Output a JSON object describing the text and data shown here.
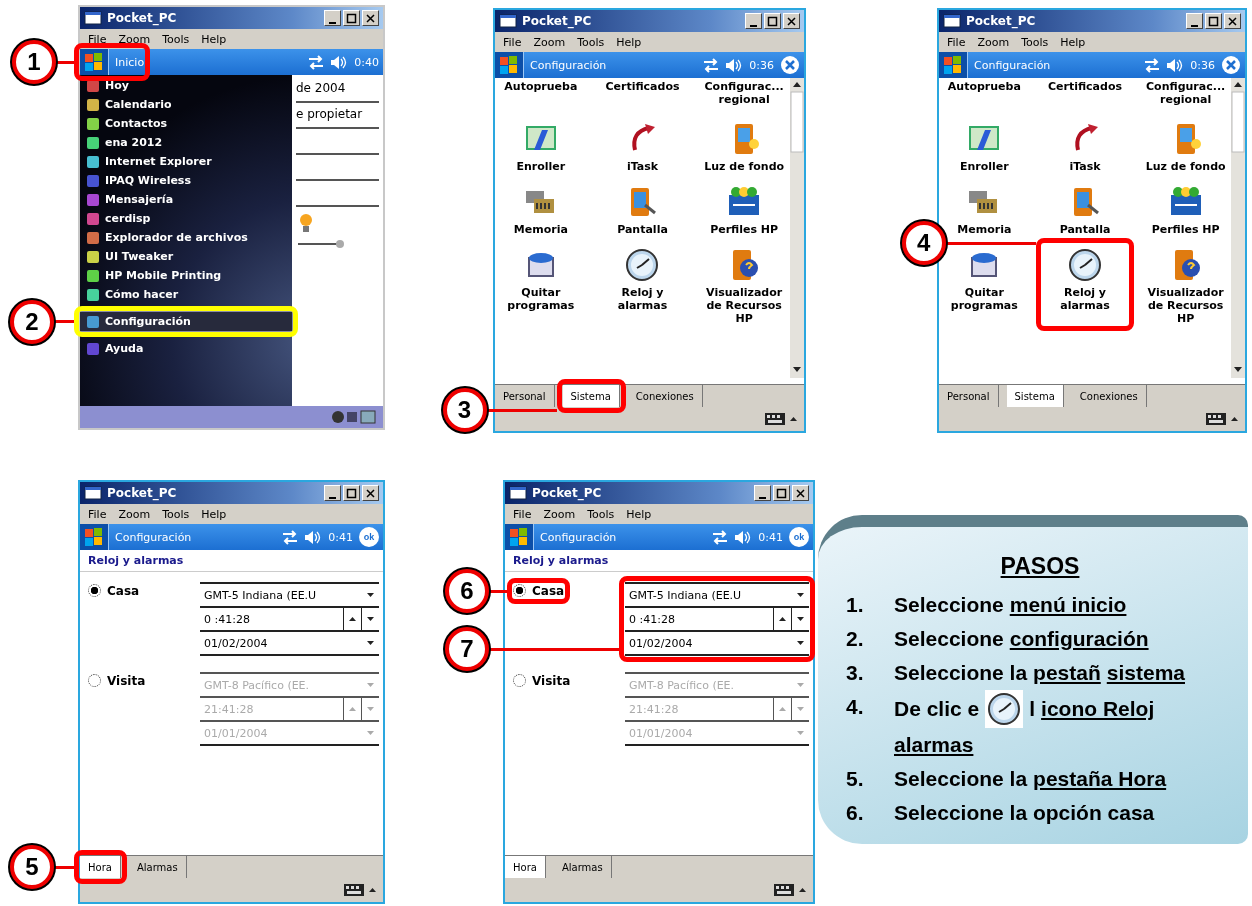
{
  "screens": [
    {
      "kind": "start_menu",
      "title": "Pocket_PC",
      "menus": [
        "File",
        "Zoom",
        "Tools",
        "Help"
      ],
      "nav_title": "Inicio",
      "time": "0:40",
      "menu_items": [
        {
          "label": "Hoy",
          "selected": false
        },
        {
          "label": "Calendario",
          "selected": false
        },
        {
          "label": "Contactos",
          "selected": false
        },
        {
          "label": "ena 2012",
          "selected": false
        },
        {
          "label": "Internet Explorer",
          "selected": false
        },
        {
          "label": "IPAQ Wireless",
          "selected": false
        },
        {
          "label": "Mensajería",
          "selected": false
        },
        {
          "label": "cerdisp",
          "selected": false
        },
        {
          "label": "Explorador de archivos",
          "selected": false
        },
        {
          "label": "UI Tweaker",
          "selected": false
        },
        {
          "label": "HP Mobile Printing",
          "selected": false
        },
        {
          "label": "Cómo hacer",
          "selected": false
        },
        {
          "label": "Configuración",
          "selected": true
        },
        {
          "label": "Ayuda",
          "selected": false
        }
      ],
      "today_lines": [
        "de 2004",
        "e propietar"
      ]
    },
    {
      "kind": "settings_grid",
      "title": "Pocket_PC",
      "menus": [
        "File",
        "Zoom",
        "Tools",
        "Help"
      ],
      "nav_title": "Configuración",
      "time": "0:36",
      "nav_button": {
        "kind": "close"
      },
      "top_labels": [
        "Autoprueba",
        "Certificados",
        "Configurac... regional"
      ],
      "items": [
        {
          "label": "Enroller"
        },
        {
          "label": "iTask"
        },
        {
          "label": "Luz de fondo"
        },
        {
          "label": "Memoria"
        },
        {
          "label": "Pantalla"
        },
        {
          "label": "Perfiles HP"
        },
        {
          "label": "Quitar programas"
        },
        {
          "label": "Reloj y alarmas"
        },
        {
          "label": "Visualizador de Recursos HP"
        }
      ],
      "tabs": [
        {
          "label": "Personal",
          "selected": false
        },
        {
          "label": "Sistema",
          "selected": true
        },
        {
          "label": "Conexiones",
          "selected": false
        }
      ]
    },
    {
      "kind": "settings_grid",
      "title": "Pocket_PC",
      "menus": [
        "File",
        "Zoom",
        "Tools",
        "Help"
      ],
      "nav_title": "Configuración",
      "time": "0:36",
      "nav_button": {
        "kind": "close"
      },
      "top_labels": [
        "Autoprueba",
        "Certificados",
        "Configurac... regional"
      ],
      "items": [
        {
          "label": "Enroller"
        },
        {
          "label": "iTask"
        },
        {
          "label": "Luz de fondo"
        },
        {
          "label": "Memoria"
        },
        {
          "label": "Pantalla"
        },
        {
          "label": "Perfiles HP"
        },
        {
          "label": "Quitar programas"
        },
        {
          "label": "Reloj y alarmas"
        },
        {
          "label": "Visualizador de Recursos HP"
        }
      ],
      "tabs": [
        {
          "label": "Personal",
          "selected": false
        },
        {
          "label": "Sistema",
          "selected": true
        },
        {
          "label": "Conexiones",
          "selected": false
        }
      ]
    },
    {
      "kind": "clock",
      "title": "Pocket_PC",
      "menus": [
        "File",
        "Zoom",
        "Tools",
        "Help"
      ],
      "nav_title": "Configuración",
      "time": "0:41",
      "nav_button": {
        "kind": "ok",
        "label": "ok"
      },
      "heading": "Reloj y alarmas",
      "zones": [
        {
          "label": "Casa",
          "selected": true,
          "disabled": false,
          "zone": "GMT-5 Indiana (EE.U",
          "time": "0 :41:28",
          "date": "01/02/2004"
        },
        {
          "label": "Visita",
          "selected": false,
          "disabled": true,
          "zone": "GMT-8 Pacífico (EE.",
          "time": "21:41:28",
          "date": "01/01/2004"
        }
      ],
      "tabs": [
        {
          "label": "Hora",
          "selected": true
        },
        {
          "label": "Alarmas",
          "selected": false
        }
      ]
    },
    {
      "kind": "clock",
      "title": "Pocket_PC",
      "menus": [
        "File",
        "Zoom",
        "Tools",
        "Help"
      ],
      "nav_title": "Configuración",
      "time": "0:41",
      "nav_button": {
        "kind": "ok",
        "label": "ok"
      },
      "heading": "Reloj y alarmas",
      "zones": [
        {
          "label": "Casa",
          "selected": true,
          "disabled": false,
          "zone": "GMT-5 Indiana (EE.U",
          "time": "0 :41:28",
          "date": "01/02/2004"
        },
        {
          "label": "Visita",
          "selected": false,
          "disabled": true,
          "zone": "GMT-8 Pacífico (EE.",
          "time": "21:41:28",
          "date": "01/01/2004"
        }
      ],
      "tabs": [
        {
          "label": "Hora",
          "selected": true
        },
        {
          "label": "Alarmas",
          "selected": false
        }
      ]
    }
  ],
  "callouts": [
    {
      "number": "1",
      "color": "#ff0000"
    },
    {
      "number": "2",
      "color": "#ffff00"
    },
    {
      "number": "3",
      "color": "#ff0000"
    },
    {
      "number": "4",
      "color": "#ff0000"
    },
    {
      "number": "5",
      "color": "#ff0000"
    },
    {
      "number": "6",
      "color": "#ff0000"
    },
    {
      "number": "7",
      "color": "#ff0000"
    }
  ],
  "steps": {
    "title": "PASOS",
    "items": [
      {
        "number": "1.",
        "parts": [
          {
            "text": "Seleccione ",
            "underline": false
          },
          {
            "text": "menú inicio",
            "underline": true
          }
        ]
      },
      {
        "number": "2.",
        "parts": [
          {
            "text": "Seleccione ",
            "underline": false
          },
          {
            "text": "configuración",
            "underline": true
          }
        ]
      },
      {
        "number": "3.",
        "parts": [
          {
            "text": "Seleccione la ",
            "underline": false
          },
          {
            "text": "pestañ",
            "underline": true
          },
          {
            "text": "sistema",
            "underline": true
          }
        ]
      },
      {
        "number": "4.",
        "parts": [
          {
            "text": "De clic e",
            "underline": false
          },
          {
            "kind": "icon"
          },
          {
            "text": "l",
            "underline": false
          },
          {
            "text": "icono Reloj",
            "underline": true
          },
          {
            "text": "alarmas",
            "underline": true
          }
        ]
      },
      {
        "number": "5.",
        "parts": [
          {
            "text": "Seleccione la ",
            "underline": false
          },
          {
            "text": "pestaña Hora",
            "underline": true
          }
        ]
      },
      {
        "number": "6.",
        "parts": [
          {
            "text": "Seleccione la opción casa",
            "underline": false
          }
        ]
      }
    ]
  }
}
